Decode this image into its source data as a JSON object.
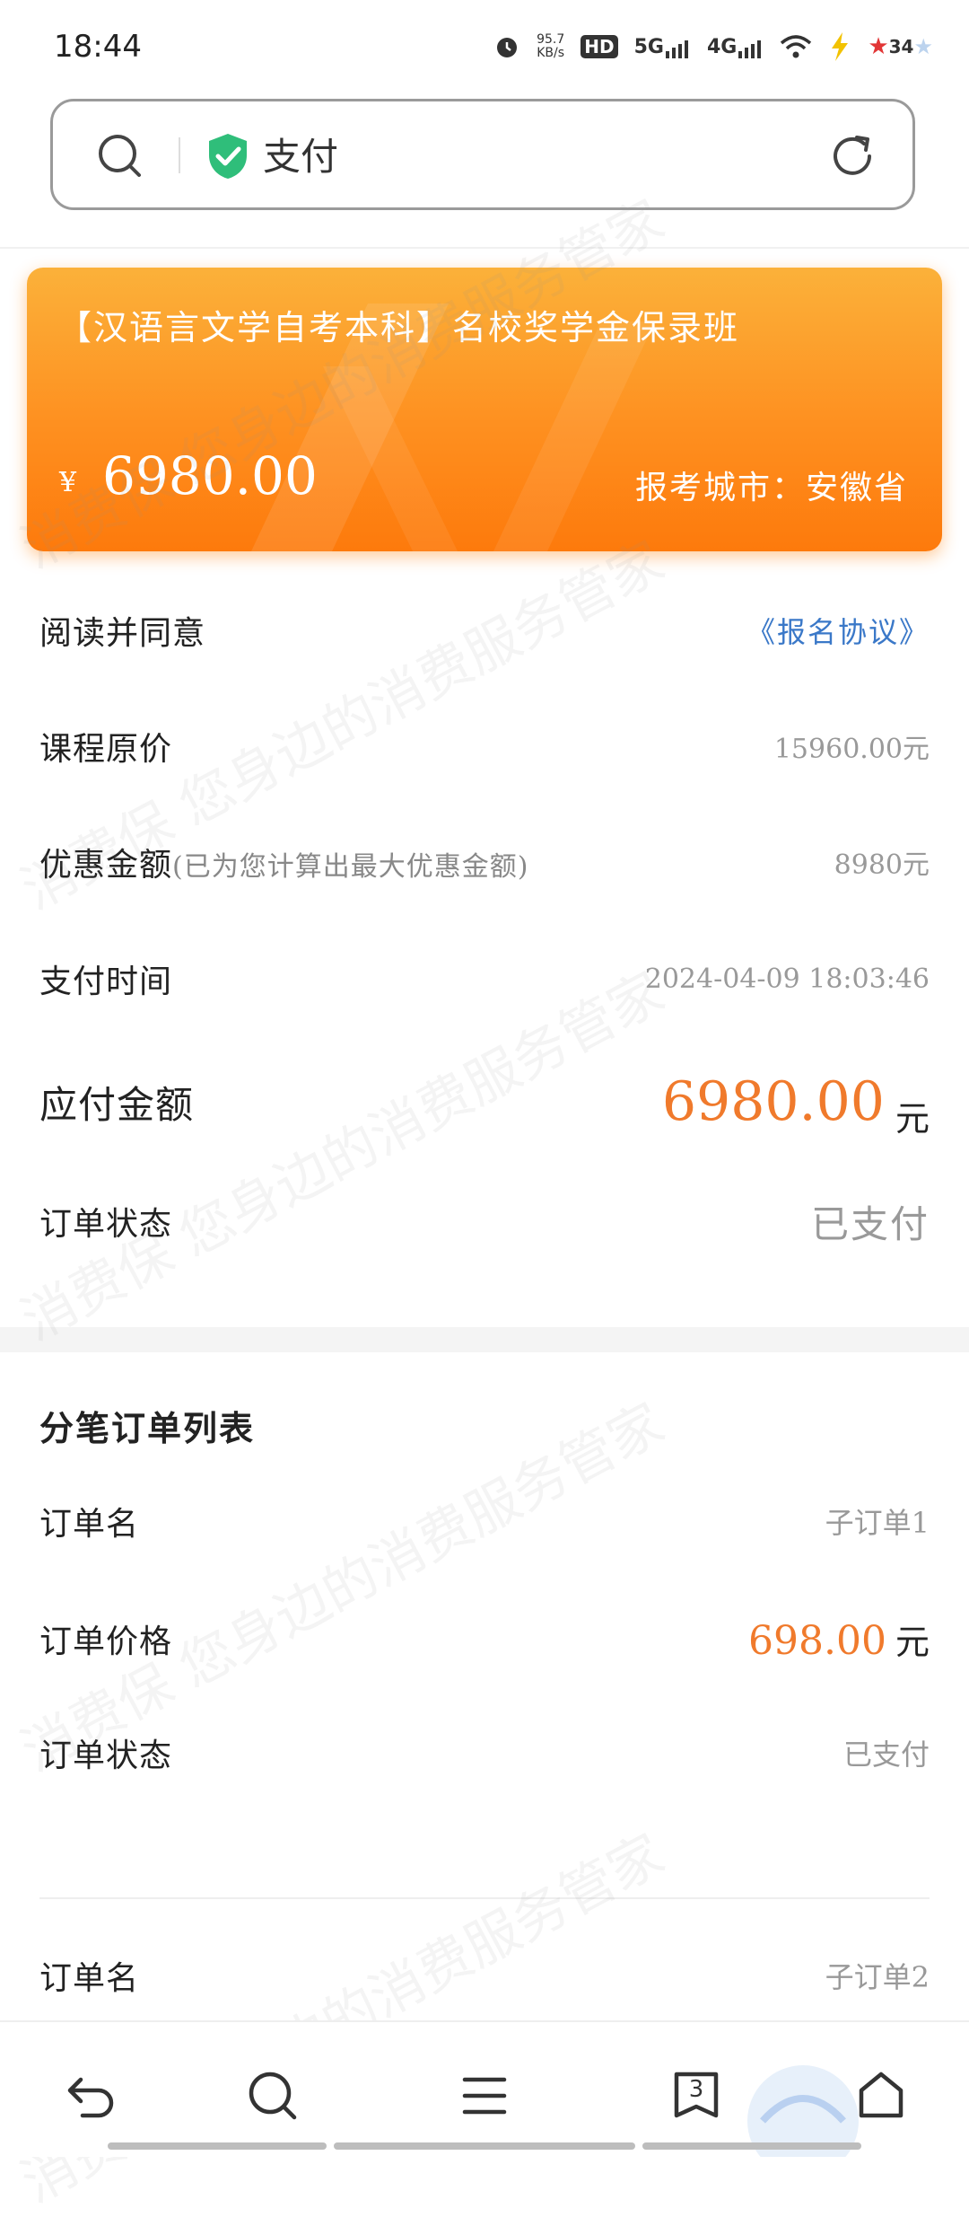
{
  "status_bar": {
    "time": "18:44",
    "net_speed_value": "95.7",
    "net_speed_unit": "KB/s",
    "hd_label": "HD",
    "sim1_label": "5G",
    "sim2_label": "4G",
    "notify_count": "34",
    "icons": [
      "alarm-icon",
      "hd-icon",
      "signal-5g-icon",
      "signal-4g-icon",
      "wifi-icon",
      "battery-charging-icon",
      "star-icon"
    ]
  },
  "address_bar": {
    "text": "支付",
    "icons": [
      "search-icon",
      "shield-check-icon",
      "refresh-icon"
    ],
    "shield_color": "#2fbe7a"
  },
  "course_card": {
    "title": "【汉语言文学自考本科】名校奖学金保录班",
    "currency": "¥",
    "price": "6980.00",
    "city": "报考城市：安徽省"
  },
  "details": {
    "agreement_label": "阅读并同意",
    "agreement_link": "《报名协议》",
    "original_price_label": "课程原价",
    "original_price_value": "15960.00元",
    "discount_label": "优惠金额",
    "discount_note": "(已为您计算出最大优惠金额)",
    "discount_value": "8980元",
    "pay_time_label": "支付时间",
    "pay_time_value": "2024-04-09 18:03:46",
    "payable_label": "应付金额",
    "payable_value": "6980.00",
    "payable_unit": "元",
    "order_status_label": "订单状态",
    "order_status_value": "已支付"
  },
  "split_orders": {
    "title": "分笔订单列表",
    "items": [
      {
        "name_label": "订单名",
        "name_value": "子订单1",
        "price_label": "订单价格",
        "price_value": "698.00",
        "price_unit": "元",
        "status_label": "订单状态",
        "status_value": "已支付"
      },
      {
        "name_label": "订单名",
        "name_value": "子订单2"
      }
    ]
  },
  "bottom_nav": {
    "tab_count": "3",
    "icons": [
      "back-icon",
      "search-icon",
      "menu-icon",
      "tabs-icon",
      "home-icon"
    ]
  },
  "watermark": "消费保 您身边的消费服务管家",
  "colors": {
    "accent_orange": "#f07a2c",
    "link_blue": "#3a78c8",
    "card_gradient_top": "#fbb13a",
    "card_gradient_bottom": "#fd7a0c"
  }
}
